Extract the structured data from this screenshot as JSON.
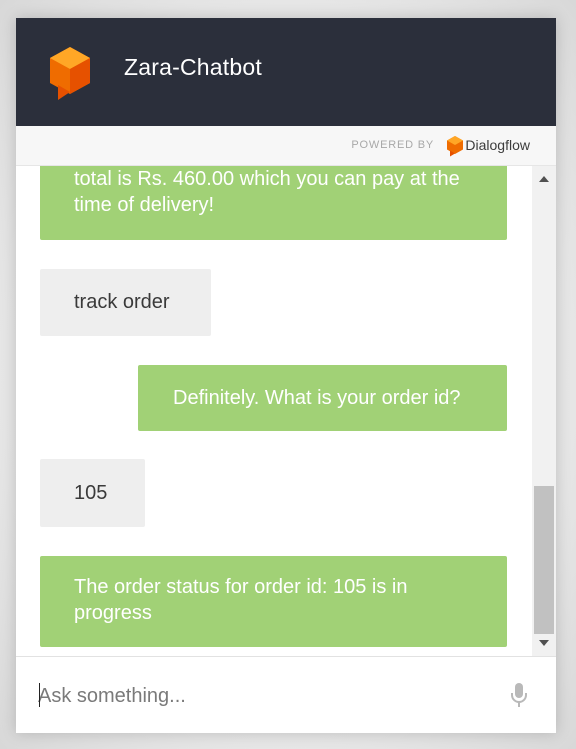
{
  "header": {
    "title": "Zara-Chatbot",
    "background": "#2b2f3b",
    "logo_icon": "dialogflow-logo-icon",
    "logo_color": "#f57c00"
  },
  "powered_by": {
    "label": "POWERED BY",
    "brand": "Dialogflow",
    "brand_icon": "dialogflow-icon"
  },
  "messages": [
    {
      "sender": "bot",
      "text": "total is Rs. 460.00 which you can pay at the time of delivery!"
    },
    {
      "sender": "user",
      "text": "track order"
    },
    {
      "sender": "bot",
      "text": "Definitely. What is your order id?"
    },
    {
      "sender": "user",
      "text": "105"
    },
    {
      "sender": "bot",
      "text": "The order status for order id: 105 is in progress"
    }
  ],
  "colors": {
    "bot_bubble": "#a1d176",
    "user_bubble": "#eeeeee"
  },
  "input": {
    "placeholder": "Ask something...",
    "value": "",
    "mic_icon": "microphone-icon"
  }
}
